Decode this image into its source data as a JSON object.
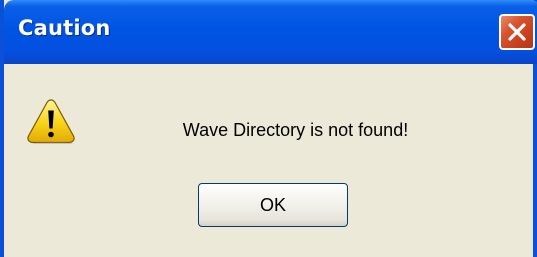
{
  "window": {
    "title": "Caution",
    "close_icon": "close-icon",
    "close_color": "#d8532f",
    "titlebar_color": "#0054e3"
  },
  "content": {
    "icon": "warning-icon",
    "icon_color": "#f7d414",
    "message": "Wave Directory is not found!"
  },
  "buttons": {
    "ok_label": "OK"
  }
}
